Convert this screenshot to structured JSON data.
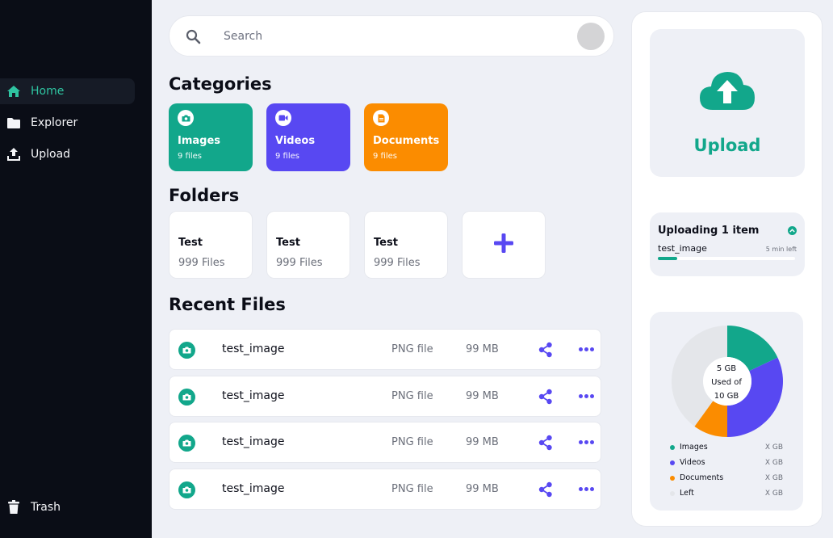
{
  "sidebar": {
    "items": [
      {
        "label": "Home",
        "icon": "home-icon",
        "active": true
      },
      {
        "label": "Explorer",
        "icon": "folder-icon",
        "active": false
      },
      {
        "label": "Upload",
        "icon": "upload-icon",
        "active": false
      }
    ],
    "trash_label": "Trash"
  },
  "search": {
    "placeholder": "Search"
  },
  "sections": {
    "categories": "Categories",
    "folders": "Folders",
    "recent": "Recent Files"
  },
  "categories": [
    {
      "name": "Images",
      "count": "9 files",
      "color": "#12a78b",
      "icon": "camera-icon"
    },
    {
      "name": "Videos",
      "count": "9 files",
      "color": "#5848f2",
      "icon": "video-icon"
    },
    {
      "name": "Documents",
      "count": "9 files",
      "color": "#fb8c00",
      "icon": "document-icon"
    }
  ],
  "folders": [
    {
      "name": "Test",
      "count": "999 Files"
    },
    {
      "name": "Test",
      "count": "999 Files"
    },
    {
      "name": "Test",
      "count": "999 Files"
    }
  ],
  "recent_files": [
    {
      "name": "test_image",
      "type": "PNG file",
      "size": "99 MB"
    },
    {
      "name": "test_image",
      "type": "PNG file",
      "size": "99 MB"
    },
    {
      "name": "test_image",
      "type": "PNG file",
      "size": "99 MB"
    },
    {
      "name": "test_image",
      "type": "PNG file",
      "size": "99 MB"
    }
  ],
  "upload": {
    "label": "Upload"
  },
  "progress": {
    "title": "Uploading 1 item",
    "file": "test_image",
    "time_left": "5 min left",
    "fraction": 0.14
  },
  "storage": {
    "center_line1": "5 GB",
    "center_line2": "Used of",
    "center_line3": "10 GB",
    "legend": [
      {
        "label": "Images",
        "value": "X GB",
        "color": "#12a78b"
      },
      {
        "label": "Videos",
        "value": "X GB",
        "color": "#5848f2"
      },
      {
        "label": "Documents",
        "value": "X GB",
        "color": "#fb8c00"
      },
      {
        "label": "Left",
        "value": "X GB",
        "color": "#e4e6ea"
      }
    ],
    "slices": [
      {
        "label": "Images",
        "value": 0.18,
        "color": "#12a78b"
      },
      {
        "label": "Videos",
        "value": 0.32,
        "color": "#5848f2"
      },
      {
        "label": "Documents",
        "value": 0.1,
        "color": "#fb8c00"
      },
      {
        "label": "Left",
        "value": 0.4,
        "color": "#e4e6ea"
      }
    ]
  },
  "colors": {
    "accent": "#12a78b",
    "purple": "#5848f2",
    "orange": "#fb8c00",
    "sidebar": "#0a0d16"
  }
}
